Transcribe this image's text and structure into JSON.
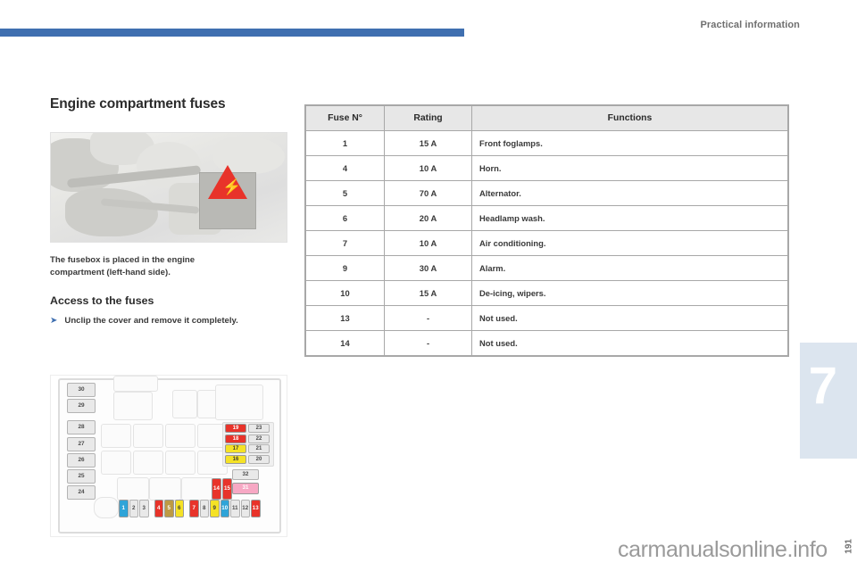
{
  "header": {
    "chapter_title": "Practical information",
    "rule_color": "#3f6fb0"
  },
  "chapter_tab": {
    "number": "7",
    "background": "#dce5ef"
  },
  "left": {
    "section_title": "Engine compartment fuses",
    "photo": {
      "name": "engine-bay-photo",
      "callout_icon": "lightning-bolt-icon"
    },
    "photo_caption": "The fusebox is placed in the engine compartment (left-hand side).",
    "subsection_title": "Access to the fuses",
    "bullet": {
      "arrow_icon": "arrow-right-icon",
      "text": "Unclip the cover and remove it completely."
    }
  },
  "diagram": {
    "name": "fusebox-layout-diagram",
    "left_column_fuses": [
      {
        "label": "30",
        "color": "grey"
      },
      {
        "label": "29",
        "color": "grey"
      },
      {
        "label": "28",
        "color": "grey"
      },
      {
        "label": "27",
        "color": "grey"
      },
      {
        "label": "26",
        "color": "grey"
      },
      {
        "label": "25",
        "color": "grey"
      },
      {
        "label": "24",
        "color": "grey"
      }
    ],
    "right_cluster_fuses": [
      {
        "label": "19",
        "color": "red"
      },
      {
        "label": "23",
        "color": "grey"
      },
      {
        "label": "18",
        "color": "red"
      },
      {
        "label": "22",
        "color": "grey"
      },
      {
        "label": "17",
        "color": "yellow"
      },
      {
        "label": "21",
        "color": "grey"
      },
      {
        "label": "16",
        "color": "yellow"
      },
      {
        "label": "20",
        "color": "grey"
      }
    ],
    "mid_right_fuses": [
      {
        "label": "32",
        "color": "grey"
      },
      {
        "label": "31",
        "color": "pink"
      },
      {
        "label": "14",
        "color": "red"
      },
      {
        "label": "15",
        "color": "red"
      }
    ],
    "bottom_row_fuses": [
      {
        "label": "1",
        "color": "blue"
      },
      {
        "label": "2",
        "color": "grey"
      },
      {
        "label": "3",
        "color": "grey"
      },
      {
        "label": "4",
        "color": "red"
      },
      {
        "label": "5",
        "color": "tan"
      },
      {
        "label": "6",
        "color": "yellow"
      },
      {
        "label": "7",
        "color": "red"
      },
      {
        "label": "8",
        "color": "grey"
      },
      {
        "label": "9",
        "color": "yellow"
      },
      {
        "label": "10",
        "color": "blue"
      },
      {
        "label": "11",
        "color": "grey"
      },
      {
        "label": "12",
        "color": "grey"
      },
      {
        "label": "13",
        "color": "red"
      }
    ]
  },
  "table": {
    "headers": [
      "Fuse N°",
      "Rating",
      "Functions"
    ],
    "rows": [
      {
        "fuse": "1",
        "rating": "15 A",
        "function": "Front foglamps."
      },
      {
        "fuse": "4",
        "rating": "10 A",
        "function": "Horn."
      },
      {
        "fuse": "5",
        "rating": "70 A",
        "function": "Alternator."
      },
      {
        "fuse": "6",
        "rating": "20 A",
        "function": "Headlamp wash."
      },
      {
        "fuse": "7",
        "rating": "10 A",
        "function": "Air conditioning."
      },
      {
        "fuse": "9",
        "rating": "30 A",
        "function": "Alarm."
      },
      {
        "fuse": "10",
        "rating": "15 A",
        "function": "De-icing, wipers."
      },
      {
        "fuse": "13",
        "rating": "-",
        "function": "Not used."
      },
      {
        "fuse": "14",
        "rating": "-",
        "function": "Not used."
      }
    ]
  },
  "footer": {
    "watermark": "carmanualsonline.info",
    "page_number": "191"
  }
}
